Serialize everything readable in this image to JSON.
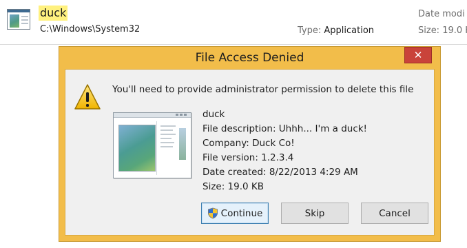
{
  "search_result": {
    "name": "duck",
    "path": "C:\\Windows\\System32",
    "type_label": "Type: ",
    "type_value": "Application",
    "date_label": "Date modi",
    "size_label": "Size: 19.0 K"
  },
  "dialog": {
    "title": "File Access Denied",
    "close_glyph": "✕",
    "message": "You'll need to provide administrator permission to delete this file",
    "file": {
      "name": "duck",
      "description": "File description: Uhhh... I'm a duck!",
      "company": "Company: Duck Co!",
      "version": "File version: 1.2.3.4",
      "date_created": "Date created: 8/22/2013 4:29 AM",
      "size": "Size: 19.0 KB"
    },
    "buttons": {
      "continue": "Continue",
      "skip": "Skip",
      "cancel": "Cancel"
    }
  },
  "colors": {
    "dialog_frame": "#f2bd4a",
    "close_button": "#c9433a",
    "highlight": "#fff17f"
  }
}
